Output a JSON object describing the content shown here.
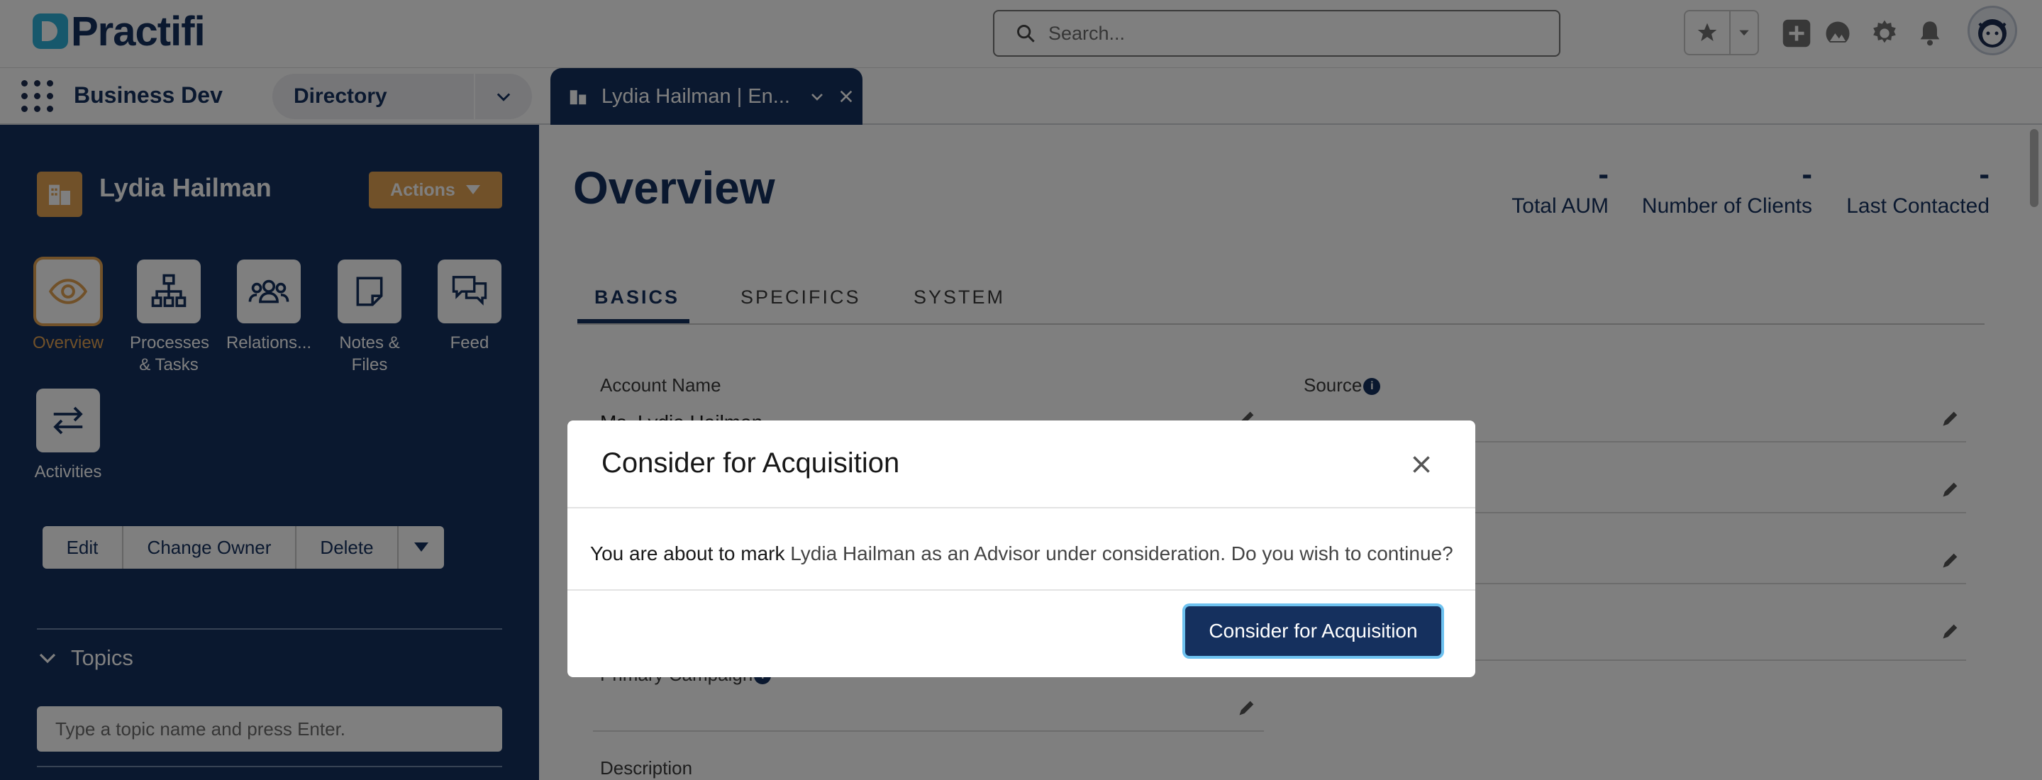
{
  "header": {
    "logo_text": "Practifi",
    "search_placeholder": "Search...",
    "icons": [
      "star-icon",
      "chevron-down-icon",
      "plus-icon",
      "trailhead-icon",
      "gear-icon",
      "bell-icon",
      "avatar"
    ]
  },
  "nav": {
    "app_name": "Business Dev",
    "directory_label": "Directory",
    "tab_label": "Lydia Hailman | En..."
  },
  "sidebar": {
    "record_name": "Lydia Hailman",
    "actions_label": "Actions",
    "tiles": [
      {
        "label": "Overview",
        "icon": "eye-icon"
      },
      {
        "label": "Processes & Tasks",
        "icon": "hierarchy-icon"
      },
      {
        "label": "Relations...",
        "icon": "people-icon"
      },
      {
        "label": "Notes & Files",
        "icon": "note-icon"
      },
      {
        "label": "Feed",
        "icon": "chat-icon"
      },
      {
        "label": "Activities",
        "icon": "swap-icon"
      }
    ],
    "buttons": {
      "edit": "Edit",
      "change_owner": "Change Owner",
      "delete": "Delete"
    },
    "topics_label": "Topics",
    "topic_placeholder": "Type a topic name and press Enter."
  },
  "main": {
    "title": "Overview",
    "stats": [
      {
        "value": "-",
        "label": "Total AUM"
      },
      {
        "value": "-",
        "label": "Number of Clients"
      },
      {
        "value": "-",
        "label": "Last Contacted"
      }
    ],
    "tabs": [
      "BASICS",
      "SPECIFICS",
      "SYSTEM"
    ],
    "fields": {
      "account_name_label": "Account Name",
      "account_name_value": "Ms. Lydia Hailman",
      "source_label": "Source",
      "primary_campaign_label": "Primary Campaign",
      "description_label": "Description"
    }
  },
  "modal": {
    "title": "Consider for Acquisition",
    "body_prefix": "You are about to mark",
    "body_rest": "Lydia Hailman as an Advisor under consideration. Do you wish to continue?",
    "confirm_label": "Consider for Acquisition"
  },
  "colors": {
    "navy": "#15305e",
    "accent": "#e3a253",
    "focus": "#6ec2f0"
  }
}
